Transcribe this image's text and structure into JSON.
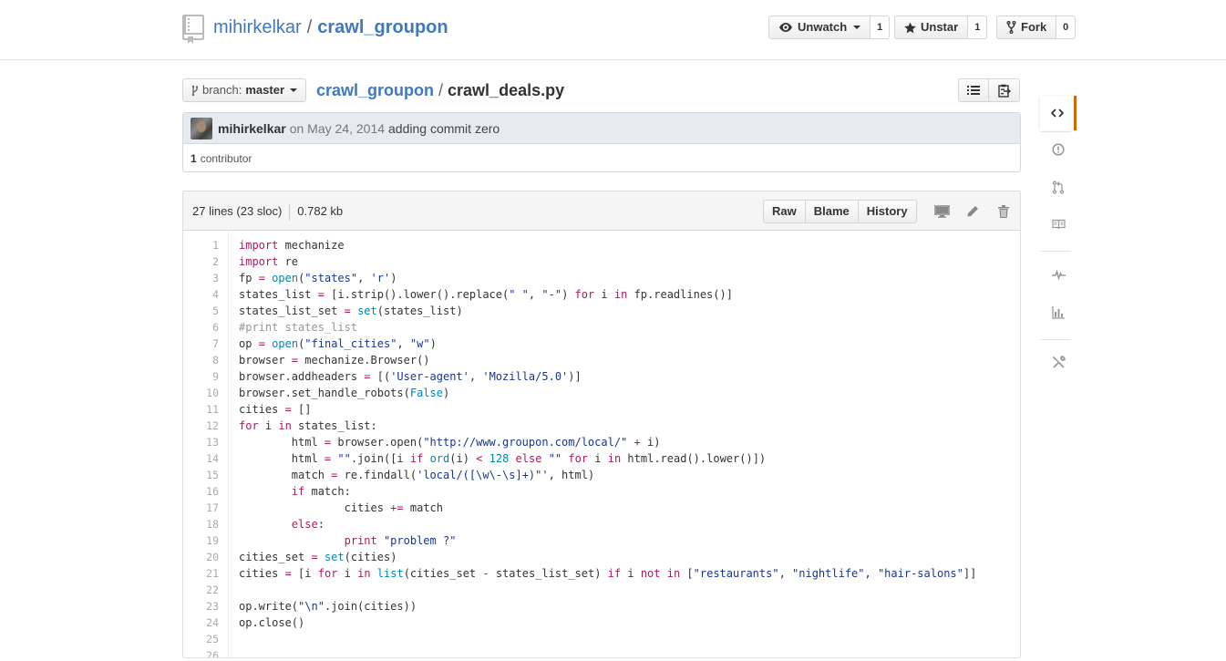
{
  "repo": {
    "owner": "mihirkelkar",
    "separator": "/",
    "name": "crawl_groupon"
  },
  "actions": {
    "watch_label": "Unwatch",
    "watch_count": "1",
    "star_label": "Unstar",
    "star_count": "1",
    "fork_label": "Fork",
    "fork_count": "0"
  },
  "branch": {
    "prefix": "branch:",
    "name": "master"
  },
  "breadcrumb": {
    "repo": "crawl_groupon",
    "separator": "/",
    "file": "crawl_deals.py"
  },
  "commit": {
    "author": "mihirkelkar",
    "date": "on May 24, 2014",
    "message": "adding commit zero",
    "contributor_count": "1",
    "contributor_label": "contributor"
  },
  "file": {
    "lines": "27 lines (23 sloc)",
    "size": "0.782 kb",
    "raw_label": "Raw",
    "blame_label": "Blame",
    "history_label": "History"
  },
  "code_lines": [
    "import mechanize",
    "import re",
    "fp = open(\"states\", 'r')",
    "states_list = [i.strip().lower().replace(\" \", \"-\") for i in fp.readlines()]",
    "states_list_set = set(states_list)",
    "#print states_list",
    "op = open(\"final_cities\", \"w\")",
    "browser = mechanize.Browser()",
    "browser.addheaders = [('User-agent', 'Mozilla/5.0')]",
    "browser.set_handle_robots(False)",
    "cities = []",
    "for i in states_list:",
    "\thtml = browser.open(\"http://www.groupon.com/local/\" + i)",
    "\thtml = \"\".join([i if ord(i) < 128 else \"\" for i in html.read().lower()])",
    "\tmatch = re.findall('local/([\\w\\-\\s]+)\"', html)",
    "\tif match:",
    "\t\tcities += match",
    "\telse:",
    "\t\tprint \"problem ?\"",
    "cities_set = set(cities)",
    "cities = [i for i in list(cities_set - states_list_set) if i not in [\"restaurants\", \"nightlife\", \"hair-salons\"]]",
    "",
    "op.write(\"\\n\".join(cities))",
    "op.close()",
    "",
    ""
  ],
  "colors": {
    "link": "#4078c0",
    "keyword": "#a71d5d",
    "string": "#183691",
    "comment": "#969896",
    "builtin": "#0086b3",
    "sidebar_active": "#d26911"
  },
  "sidebar": {
    "items": [
      "code-icon",
      "issues-icon",
      "pull-request-icon",
      "wiki-icon",
      "pulse-icon",
      "graphs-icon",
      "settings-icon"
    ]
  }
}
